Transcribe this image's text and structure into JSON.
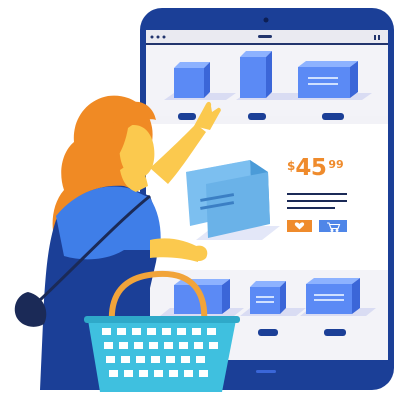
{
  "illustration": {
    "type": "online-shopping",
    "product": {
      "price_currency": "$",
      "price_main": "45",
      "price_cents": "99"
    },
    "actions": [
      {
        "icon": "heart-icon"
      },
      {
        "icon": "cart-icon"
      }
    ],
    "colors": {
      "device": "#1b3f97",
      "screen": "#f2f2f7",
      "box_blue": "#5b8af5",
      "price_orange": "#ef8b2c",
      "hair_orange": "#f08a24",
      "skin": "#fbc94e",
      "shirt_blue": "#3f7ee8",
      "basket_teal": "#3fc0df",
      "basket_handle": "#f1a43a"
    }
  }
}
